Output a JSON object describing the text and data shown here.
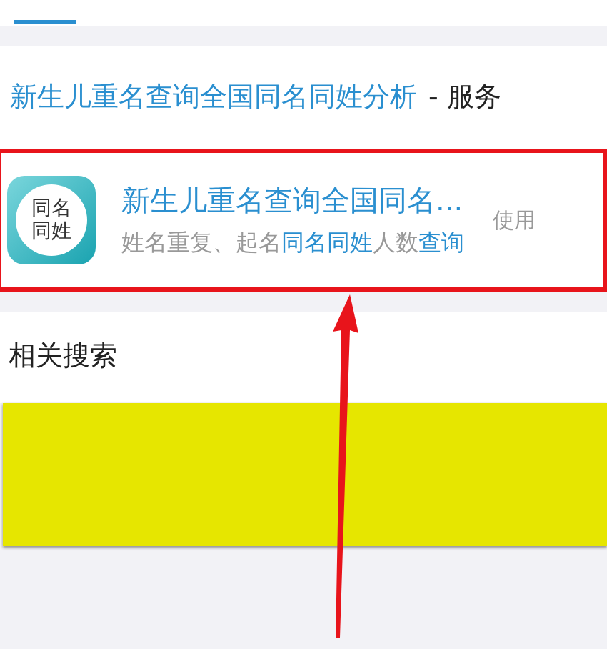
{
  "result_title": {
    "link": "新生儿重名查询全国同名同姓分析",
    "suffix": "- 服务"
  },
  "app_card": {
    "icon_lines": [
      "同名",
      "同姓"
    ],
    "name": "新生儿重名查询全国同名...",
    "description": [
      {
        "text": "姓名重复、起名",
        "highlighted": false
      },
      {
        "text": "同名同姓",
        "highlighted": true
      },
      {
        "text": "人数",
        "highlighted": false
      },
      {
        "text": "查询",
        "highlighted": true
      }
    ],
    "side_text": "使用",
    "outlined": true
  },
  "related": {
    "heading": "相关搜索",
    "redacted": true
  }
}
